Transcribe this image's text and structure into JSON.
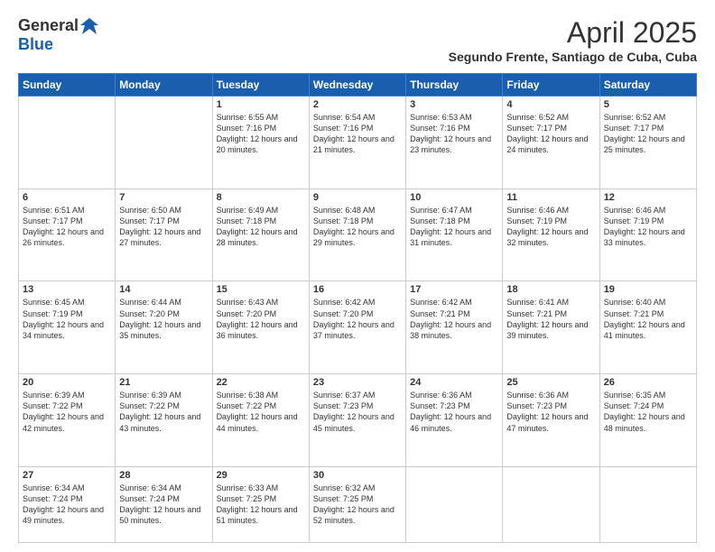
{
  "logo": {
    "general": "General",
    "blue": "Blue"
  },
  "header": {
    "month_year": "April 2025",
    "location": "Segundo Frente, Santiago de Cuba, Cuba"
  },
  "weekdays": [
    "Sunday",
    "Monday",
    "Tuesday",
    "Wednesday",
    "Thursday",
    "Friday",
    "Saturday"
  ],
  "weeks": [
    [
      {
        "day": "",
        "info": ""
      },
      {
        "day": "",
        "info": ""
      },
      {
        "day": "1",
        "info": "Sunrise: 6:55 AM\nSunset: 7:16 PM\nDaylight: 12 hours and 20 minutes."
      },
      {
        "day": "2",
        "info": "Sunrise: 6:54 AM\nSunset: 7:16 PM\nDaylight: 12 hours and 21 minutes."
      },
      {
        "day": "3",
        "info": "Sunrise: 6:53 AM\nSunset: 7:16 PM\nDaylight: 12 hours and 23 minutes."
      },
      {
        "day": "4",
        "info": "Sunrise: 6:52 AM\nSunset: 7:17 PM\nDaylight: 12 hours and 24 minutes."
      },
      {
        "day": "5",
        "info": "Sunrise: 6:52 AM\nSunset: 7:17 PM\nDaylight: 12 hours and 25 minutes."
      }
    ],
    [
      {
        "day": "6",
        "info": "Sunrise: 6:51 AM\nSunset: 7:17 PM\nDaylight: 12 hours and 26 minutes."
      },
      {
        "day": "7",
        "info": "Sunrise: 6:50 AM\nSunset: 7:17 PM\nDaylight: 12 hours and 27 minutes."
      },
      {
        "day": "8",
        "info": "Sunrise: 6:49 AM\nSunset: 7:18 PM\nDaylight: 12 hours and 28 minutes."
      },
      {
        "day": "9",
        "info": "Sunrise: 6:48 AM\nSunset: 7:18 PM\nDaylight: 12 hours and 29 minutes."
      },
      {
        "day": "10",
        "info": "Sunrise: 6:47 AM\nSunset: 7:18 PM\nDaylight: 12 hours and 31 minutes."
      },
      {
        "day": "11",
        "info": "Sunrise: 6:46 AM\nSunset: 7:19 PM\nDaylight: 12 hours and 32 minutes."
      },
      {
        "day": "12",
        "info": "Sunrise: 6:46 AM\nSunset: 7:19 PM\nDaylight: 12 hours and 33 minutes."
      }
    ],
    [
      {
        "day": "13",
        "info": "Sunrise: 6:45 AM\nSunset: 7:19 PM\nDaylight: 12 hours and 34 minutes."
      },
      {
        "day": "14",
        "info": "Sunrise: 6:44 AM\nSunset: 7:20 PM\nDaylight: 12 hours and 35 minutes."
      },
      {
        "day": "15",
        "info": "Sunrise: 6:43 AM\nSunset: 7:20 PM\nDaylight: 12 hours and 36 minutes."
      },
      {
        "day": "16",
        "info": "Sunrise: 6:42 AM\nSunset: 7:20 PM\nDaylight: 12 hours and 37 minutes."
      },
      {
        "day": "17",
        "info": "Sunrise: 6:42 AM\nSunset: 7:21 PM\nDaylight: 12 hours and 38 minutes."
      },
      {
        "day": "18",
        "info": "Sunrise: 6:41 AM\nSunset: 7:21 PM\nDaylight: 12 hours and 39 minutes."
      },
      {
        "day": "19",
        "info": "Sunrise: 6:40 AM\nSunset: 7:21 PM\nDaylight: 12 hours and 41 minutes."
      }
    ],
    [
      {
        "day": "20",
        "info": "Sunrise: 6:39 AM\nSunset: 7:22 PM\nDaylight: 12 hours and 42 minutes."
      },
      {
        "day": "21",
        "info": "Sunrise: 6:39 AM\nSunset: 7:22 PM\nDaylight: 12 hours and 43 minutes."
      },
      {
        "day": "22",
        "info": "Sunrise: 6:38 AM\nSunset: 7:22 PM\nDaylight: 12 hours and 44 minutes."
      },
      {
        "day": "23",
        "info": "Sunrise: 6:37 AM\nSunset: 7:23 PM\nDaylight: 12 hours and 45 minutes."
      },
      {
        "day": "24",
        "info": "Sunrise: 6:36 AM\nSunset: 7:23 PM\nDaylight: 12 hours and 46 minutes."
      },
      {
        "day": "25",
        "info": "Sunrise: 6:36 AM\nSunset: 7:23 PM\nDaylight: 12 hours and 47 minutes."
      },
      {
        "day": "26",
        "info": "Sunrise: 6:35 AM\nSunset: 7:24 PM\nDaylight: 12 hours and 48 minutes."
      }
    ],
    [
      {
        "day": "27",
        "info": "Sunrise: 6:34 AM\nSunset: 7:24 PM\nDaylight: 12 hours and 49 minutes."
      },
      {
        "day": "28",
        "info": "Sunrise: 6:34 AM\nSunset: 7:24 PM\nDaylight: 12 hours and 50 minutes."
      },
      {
        "day": "29",
        "info": "Sunrise: 6:33 AM\nSunset: 7:25 PM\nDaylight: 12 hours and 51 minutes."
      },
      {
        "day": "30",
        "info": "Sunrise: 6:32 AM\nSunset: 7:25 PM\nDaylight: 12 hours and 52 minutes."
      },
      {
        "day": "",
        "info": ""
      },
      {
        "day": "",
        "info": ""
      },
      {
        "day": "",
        "info": ""
      }
    ]
  ]
}
